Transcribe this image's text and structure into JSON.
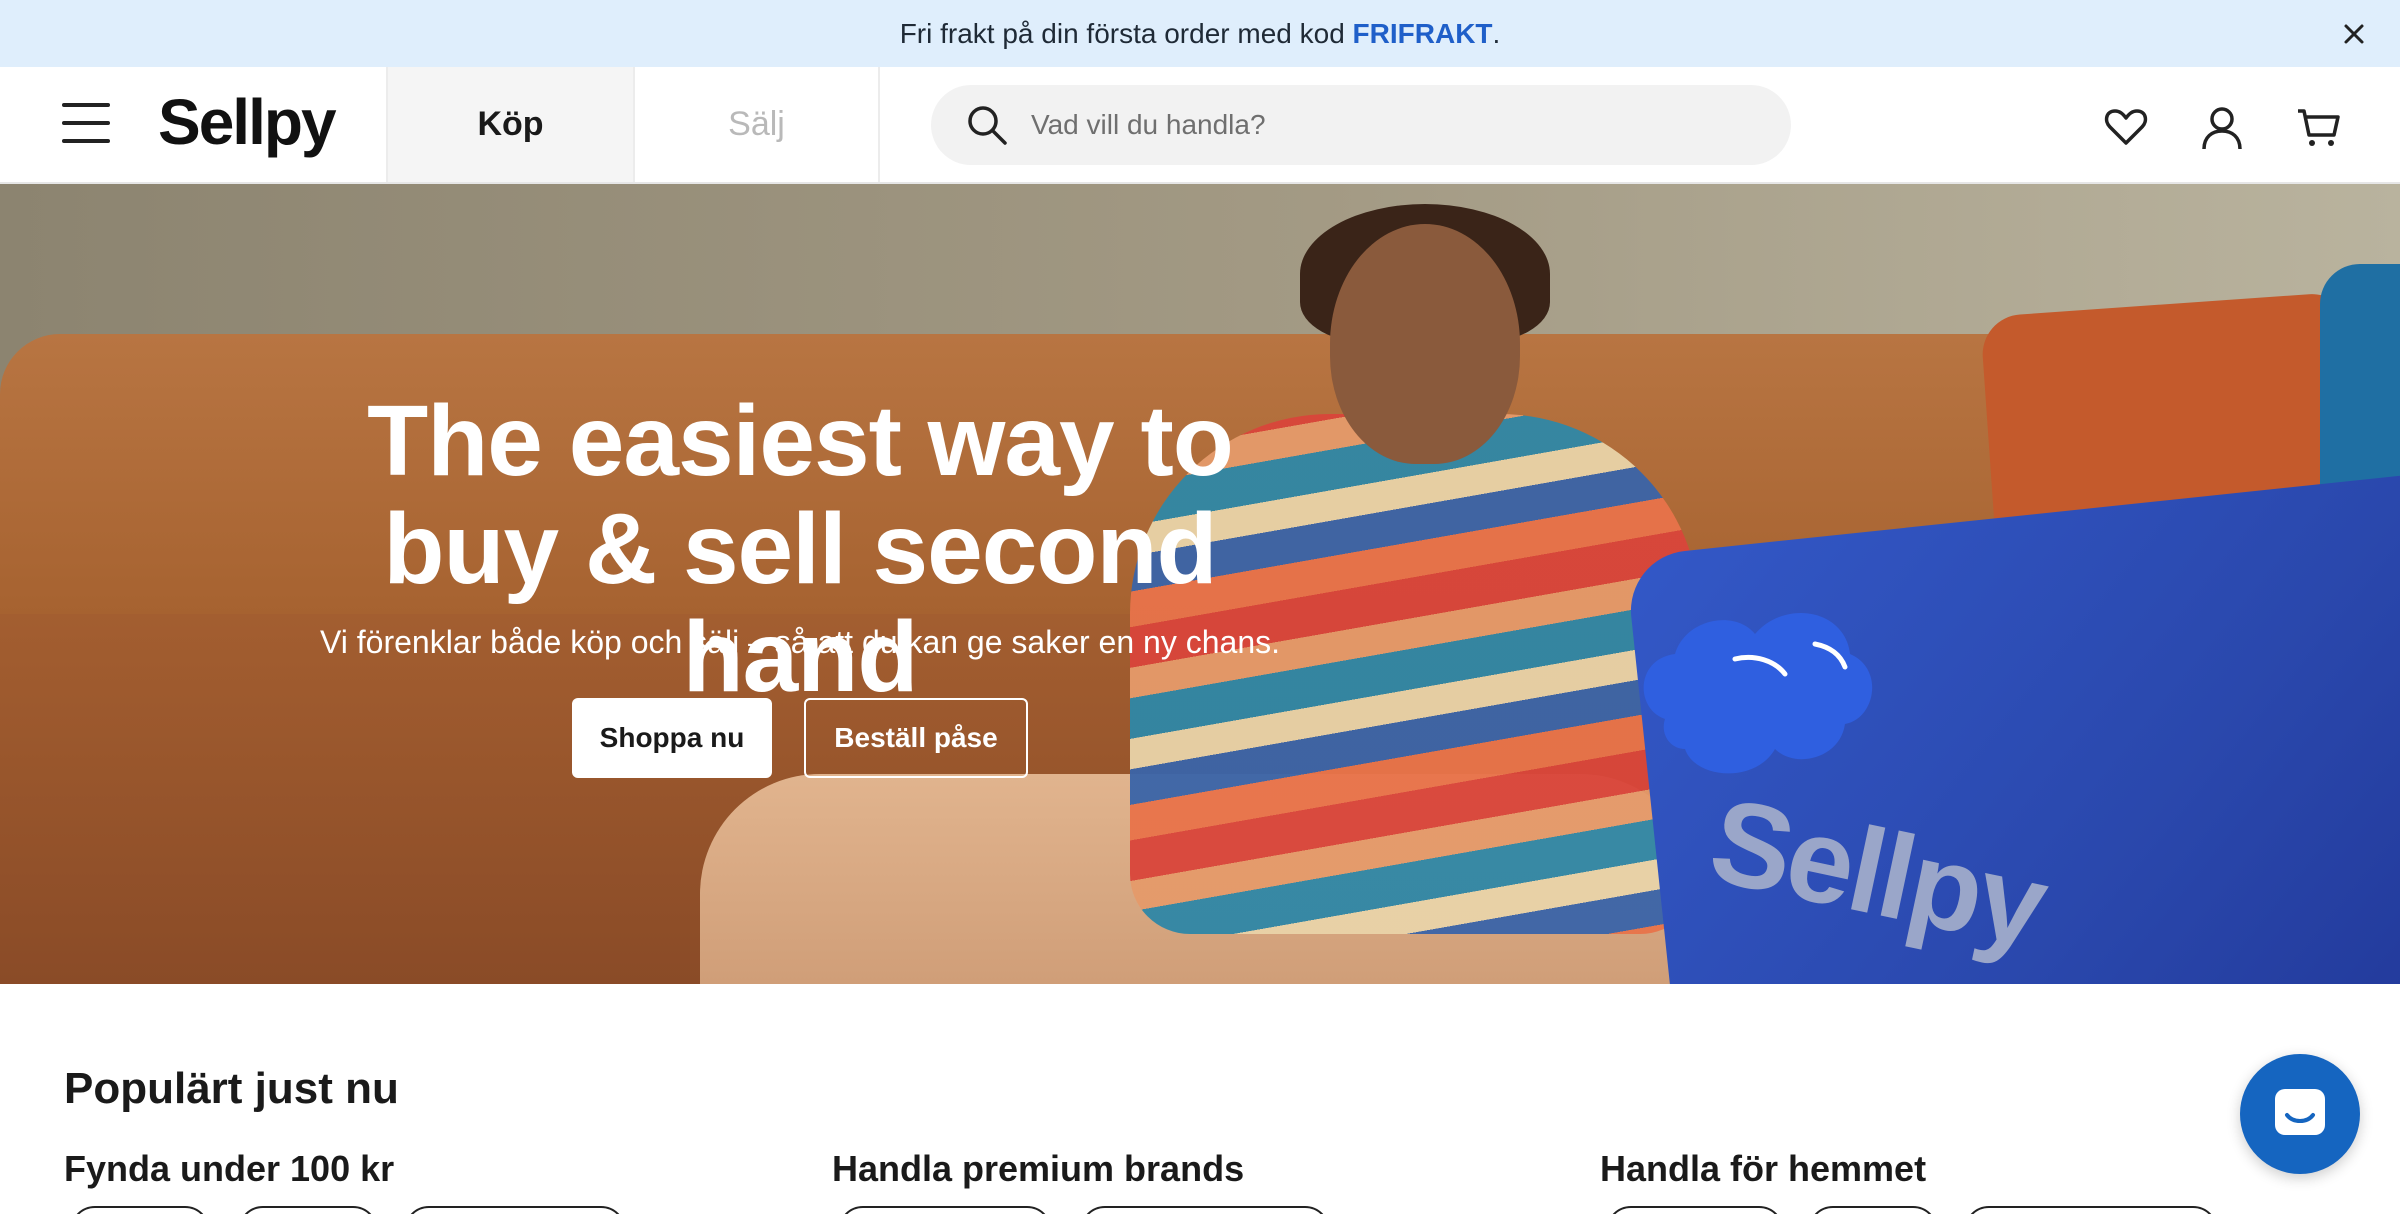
{
  "promo": {
    "text_before": "Fri frakt på din första order med kod ",
    "code": "FRIFRAKT",
    "text_after": "."
  },
  "header": {
    "logo": "Sellpy",
    "tabs": [
      {
        "label": "Köp",
        "active": true
      },
      {
        "label": "Sälj",
        "active": false
      }
    ],
    "search_placeholder": "Vad vill du handla?",
    "icons": [
      "menu-icon",
      "search-icon",
      "heart-icon",
      "user-icon",
      "cart-icon",
      "close-icon"
    ]
  },
  "hero": {
    "title_line1": "The easiest way to",
    "title_line2": "buy & sell second hand",
    "subtitle": "Vi förenklar både köp och sälj – så att du kan ge saker en ny chans.",
    "primary_button": "Shoppa nu",
    "secondary_button": "Beställ påse",
    "bag_text": "Sellpy"
  },
  "popular": {
    "title": "Populärt just nu",
    "categories": [
      {
        "title": "Fynda under 100 kr"
      },
      {
        "title": "Handla premium brands"
      },
      {
        "title": "Handla för hemmet"
      }
    ]
  },
  "colors": {
    "promo_bg": "#dfeefc",
    "promo_code": "#1f5fc9",
    "chat_button": "#1565c0"
  }
}
